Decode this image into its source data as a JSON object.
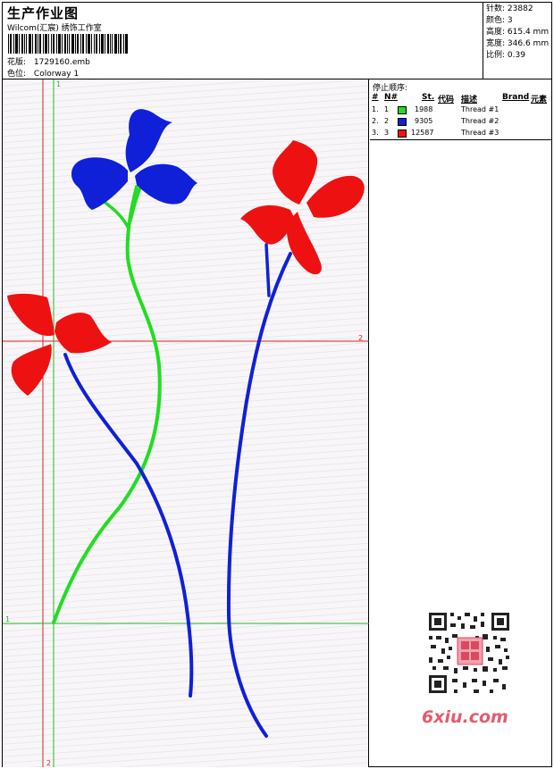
{
  "header": {
    "title": "生产作业图",
    "subtitle": "Wilcom(汇宸) 绣饰工作室",
    "design_label": "花版:",
    "design_value": "1729160.emb",
    "color_label": "色位:",
    "color_value": "Colorway 1"
  },
  "stats": {
    "stitches_label": "针数:",
    "stitches_value": "23882",
    "colors_label": "颜色:",
    "colors_value": "3",
    "height_label": "高度:",
    "height_value": "615.4 mm",
    "width_label": "宽度:",
    "width_value": "346.6 mm",
    "scale_label": "比例:",
    "scale_value": "0.39"
  },
  "stop_sequence": {
    "title": "停止顺序:",
    "columns": [
      "#",
      "N#",
      "St.",
      "代码",
      "描述",
      "Brand",
      "元素"
    ],
    "rows": [
      {
        "index": "1.",
        "n": "1",
        "color": "#22dd22",
        "code": "1988",
        "desc": "Thread #1"
      },
      {
        "index": "2.",
        "n": "2",
        "color": "#1020d8",
        "code": "9305",
        "desc": "Thread #2"
      },
      {
        "index": "3.",
        "n": "3",
        "color": "#ee1111",
        "code": "12587",
        "desc": "Thread #3"
      }
    ]
  },
  "guides": {
    "vertical_green_label": "1",
    "vertical_red_label": "2",
    "horizontal_red_label": "2",
    "horizontal_green_label": "1"
  },
  "watermark": {
    "brand": "6xiu.com"
  },
  "colors": {
    "green": "#22dd22",
    "blue": "#1020d8",
    "red": "#ee1111",
    "guide_red": "#dd2222",
    "guide_green": "#22bb22"
  }
}
